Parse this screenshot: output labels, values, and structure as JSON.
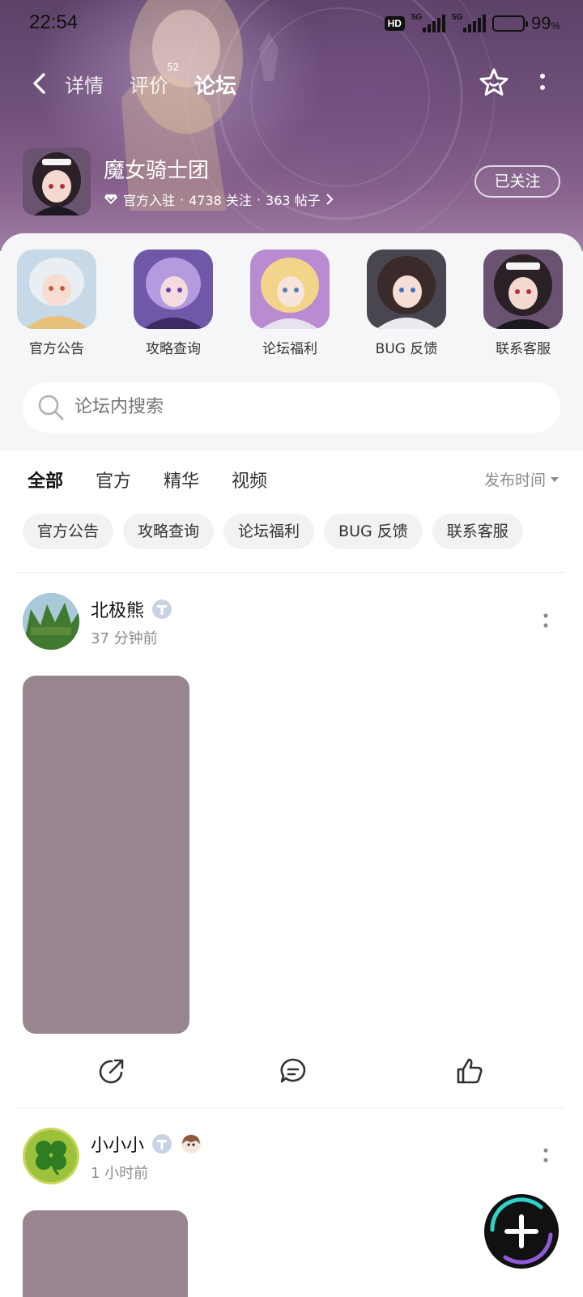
{
  "status": {
    "time": "22:54",
    "hd": "HD",
    "net1": "5G",
    "net2": "5G",
    "battery_pct": "99",
    "battery_unit": "%"
  },
  "nav": {
    "tabs": [
      {
        "label": "详情"
      },
      {
        "label": "评价",
        "count": "52"
      },
      {
        "label": "论坛"
      }
    ],
    "active_tab": "论坛",
    "icons": {
      "back": "back-arrow-icon",
      "favorite": "star-outline-icon",
      "more": "vertical-dots-icon"
    }
  },
  "game": {
    "name": "魔女骑士团",
    "badge": "官方入驻",
    "follow_count": "4738 关注",
    "post_count": "363 帖子",
    "follow_button": "已关注"
  },
  "shortcuts": [
    {
      "label": "官方公告"
    },
    {
      "label": "攻略查询"
    },
    {
      "label": "论坛福利"
    },
    {
      "label": "BUG 反馈"
    },
    {
      "label": "联系客服"
    }
  ],
  "search": {
    "placeholder": "论坛内搜索"
  },
  "filter_tabs": [
    {
      "label": "全部"
    },
    {
      "label": "官方"
    },
    {
      "label": "精华"
    },
    {
      "label": "视频"
    }
  ],
  "sort": {
    "label": "发布时间"
  },
  "chips": [
    {
      "label": "官方公告"
    },
    {
      "label": "攻略查询"
    },
    {
      "label": "论坛福利"
    },
    {
      "label": "BUG 反馈"
    },
    {
      "label": "联系客服"
    }
  ],
  "posts": [
    {
      "user": "北极熊",
      "time": "37 分钟前"
    },
    {
      "user": "小小小",
      "time": "1 小时前"
    }
  ],
  "colors": {
    "accent": "#2ed3c8",
    "hero": "#6e4f78",
    "image_placeholder": "#97858f",
    "muted_text": "#8a8c90"
  }
}
